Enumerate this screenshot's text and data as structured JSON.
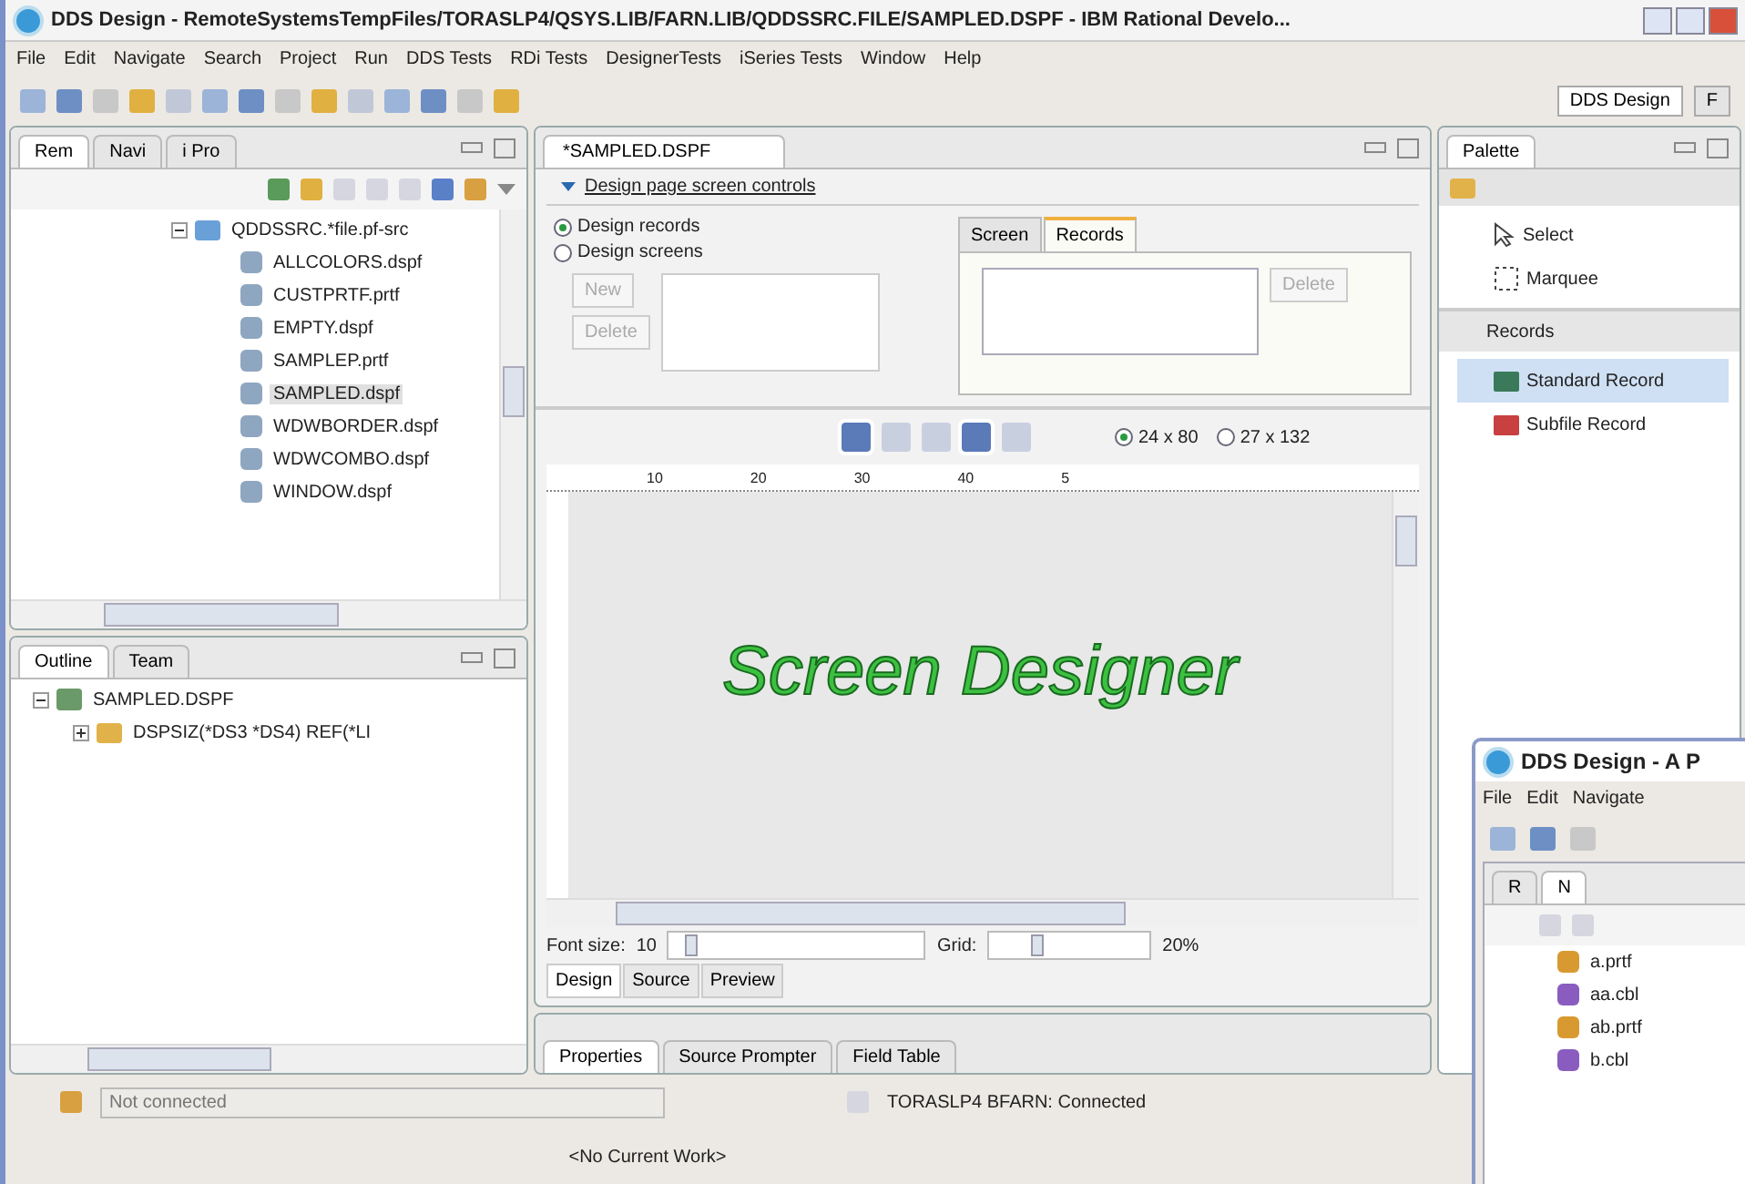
{
  "window": {
    "title": "DDS Design - RemoteSystemsTempFiles/TORASLP4/QSYS.LIB/FARN.LIB/QDDSSRC.FILE/SAMPLED.DSPF - IBM Rational Develo..."
  },
  "menu": [
    "File",
    "Edit",
    "Navigate",
    "Search",
    "Project",
    "Run",
    "DDS Tests",
    "RDi Tests",
    "DesignerTests",
    "iSeries Tests",
    "Window",
    "Help"
  ],
  "perspectives": [
    {
      "label": "DDS Design",
      "selected": true
    },
    {
      "label": "F",
      "selected": false
    }
  ],
  "remote_view": {
    "tabs": [
      {
        "label": "Rem",
        "selected": true
      },
      {
        "label": "Navi",
        "selected": false
      },
      {
        "label": "i Pro",
        "selected": false
      }
    ],
    "tree": {
      "label": "QDDSSRC.*file.pf-src",
      "expanded": true,
      "children": [
        {
          "label": "ALLCOLORS.dspf",
          "selected": false
        },
        {
          "label": "CUSTPRTF.prtf",
          "selected": false
        },
        {
          "label": "EMPTY.dspf",
          "selected": false
        },
        {
          "label": "SAMPLEP.prtf",
          "selected": false
        },
        {
          "label": "SAMPLED.dspf",
          "selected": true
        },
        {
          "label": "WDWBORDER.dspf",
          "selected": false
        },
        {
          "label": "WDWCOMBO.dspf",
          "selected": false
        },
        {
          "label": "WINDOW.dspf",
          "selected": false
        }
      ]
    }
  },
  "outline_view": {
    "tabs": [
      {
        "label": "Outline",
        "selected": true
      },
      {
        "label": "Team",
        "selected": false
      }
    ],
    "tree": {
      "label": "SAMPLED.DSPF",
      "expanded": true,
      "children": [
        {
          "label": "DSPSIZ(*DS3 *DS4) REF(*LI",
          "expanded": false
        }
      ]
    }
  },
  "editor": {
    "tab": "*SAMPLED.DSPF",
    "section": "Design page screen controls",
    "design_options": [
      {
        "label": "Design records",
        "selected": true
      },
      {
        "label": "Design screens",
        "selected": false
      }
    ],
    "buttons": [
      {
        "label": "New",
        "disabled": true
      },
      {
        "label": "Delete",
        "disabled": true
      }
    ],
    "subtabs": [
      {
        "label": "Screen",
        "selected": false
      },
      {
        "label": "Records",
        "selected": true
      }
    ],
    "subtab_button": {
      "label": "Delete",
      "disabled": true
    },
    "sizes": [
      {
        "label": "24 x 80",
        "selected": true
      },
      {
        "label": "27 x 132",
        "selected": false
      }
    ],
    "ruler_marks": [
      "10",
      "20",
      "30",
      "40",
      "5"
    ],
    "canvas_text": "Screen Designer",
    "font_size": {
      "label": "Font size:",
      "value": "10",
      "level": 0.02
    },
    "grid": {
      "label": "Grid:",
      "level": 0.25,
      "reading": "20%"
    },
    "page_tabs": [
      {
        "label": "Design",
        "selected": true
      },
      {
        "label": "Source",
        "selected": false
      },
      {
        "label": "Preview",
        "selected": false
      }
    ]
  },
  "bottom_tabs": [
    {
      "label": "Properties",
      "selected": true
    },
    {
      "label": "Source Prompter",
      "selected": false
    },
    {
      "label": "Field Table",
      "selected": false
    }
  ],
  "palette": {
    "title": "Palette",
    "tools": [
      {
        "label": "Select",
        "kind": "select"
      },
      {
        "label": "Marquee",
        "kind": "marquee"
      }
    ],
    "drawer": "Records",
    "items": [
      {
        "label": "Standard Record",
        "selected": true
      },
      {
        "label": "Subfile Record",
        "selected": false
      }
    ]
  },
  "status_bar": {
    "connection_placeholder": "Not connected",
    "connection": "TORASLP4 BFARN: Connected",
    "work": "<No Current Work>"
  },
  "second_window": {
    "title": "DDS Design - A P",
    "menu": [
      "File",
      "Edit",
      "Navigate"
    ],
    "tabs": [
      {
        "label": "R",
        "selected": false
      },
      {
        "label": "N",
        "selected": true
      }
    ],
    "files": [
      {
        "label": "a.prtf",
        "kind": "prtf"
      },
      {
        "label": "aa.cbl",
        "kind": "cbl"
      },
      {
        "label": "ab.prtf",
        "kind": "prtf"
      },
      {
        "label": "b.cbl",
        "kind": "cbl"
      }
    ]
  }
}
